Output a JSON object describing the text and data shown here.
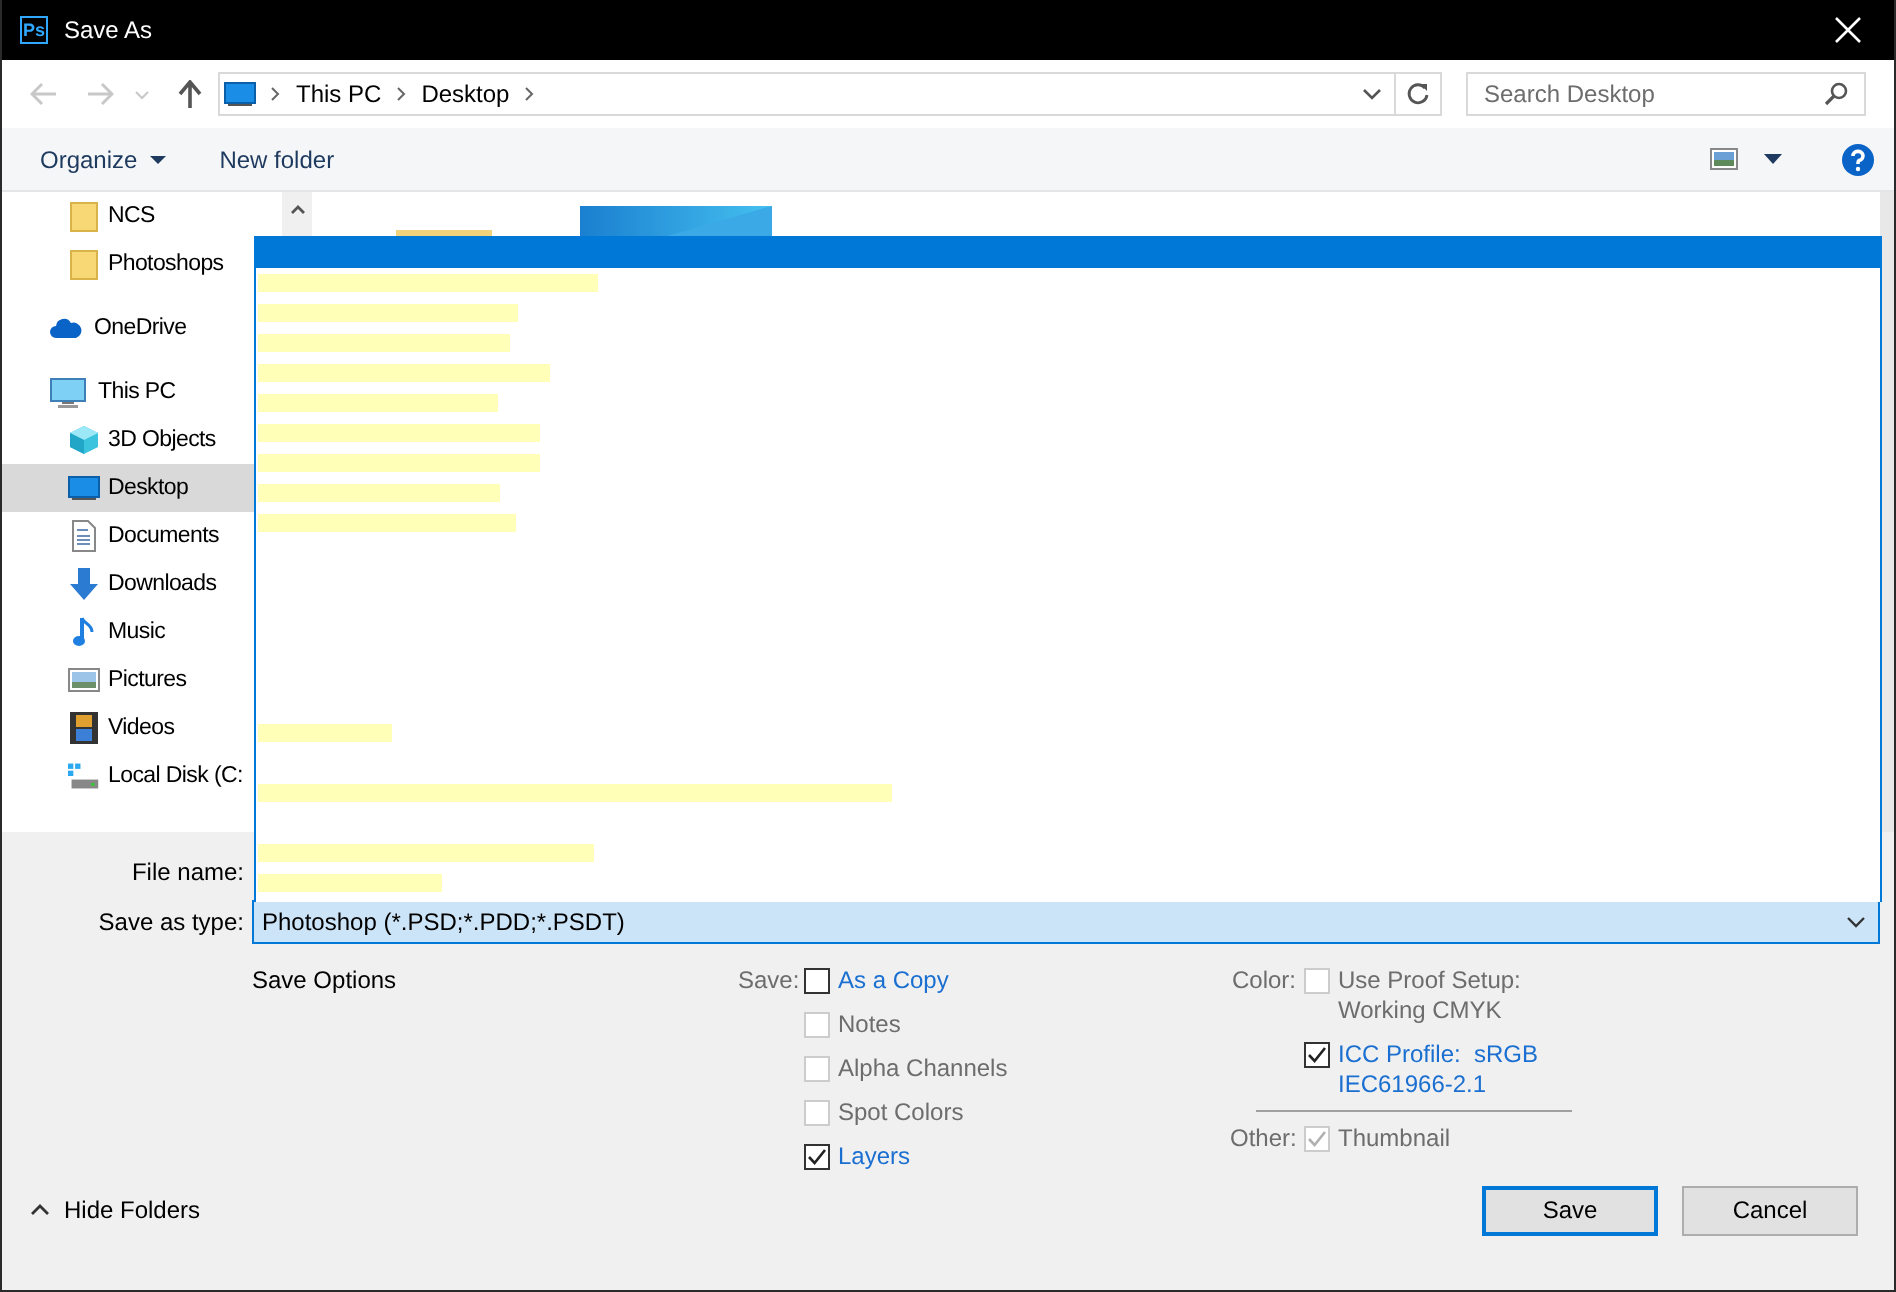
{
  "window": {
    "app_icon_text": "Ps",
    "title": "Save As"
  },
  "address": {
    "path": [
      "This PC",
      "Desktop"
    ]
  },
  "search": {
    "placeholder": "Search Desktop"
  },
  "toolbar": {
    "organize": "Organize",
    "new_folder": "New folder"
  },
  "sidebar": {
    "quick_access_items": [
      {
        "label": "NCS",
        "selected": false
      },
      {
        "label": "Photoshops",
        "selected": false
      }
    ],
    "items": [
      {
        "label": "OneDrive",
        "selected": false
      },
      {
        "label": "This PC",
        "selected": false,
        "children": [
          {
            "label": "3D Objects",
            "selected": false
          },
          {
            "label": "Desktop",
            "selected": true
          },
          {
            "label": "Documents",
            "selected": false
          },
          {
            "label": "Downloads",
            "selected": false
          },
          {
            "label": "Music",
            "selected": false
          },
          {
            "label": "Pictures",
            "selected": false
          },
          {
            "label": "Videos",
            "selected": false
          },
          {
            "label": "Local Disk (C:",
            "selected": false
          }
        ]
      }
    ]
  },
  "file_name": {
    "label": "File name:"
  },
  "save_as_type": {
    "label": "Save as type:",
    "value": "Photoshop (*.PSD;*.PDD;*.PSDT)",
    "expanded": true
  },
  "save_options": {
    "title": "Save Options",
    "save": {
      "label": "Save:",
      "options": [
        {
          "label": "As a Copy",
          "checked": false,
          "disabled": false
        },
        {
          "label": "Notes",
          "checked": false,
          "disabled": true
        },
        {
          "label": "Alpha Channels",
          "checked": false,
          "disabled": true
        },
        {
          "label": "Spot Colors",
          "checked": false,
          "disabled": true
        },
        {
          "label": "Layers",
          "checked": true,
          "disabled": false
        }
      ]
    },
    "color": {
      "label": "Color:",
      "options": [
        {
          "label": "Use Proof Setup: Working CMYK",
          "checked": false,
          "disabled": true
        },
        {
          "label": "ICC Profile:  sRGB IEC61966-2.1",
          "checked": true,
          "disabled": false
        }
      ]
    },
    "other": {
      "label": "Other:",
      "options": [
        {
          "label": "Thumbnail",
          "checked": true,
          "disabled": true
        }
      ]
    }
  },
  "hide_folders": "Hide Folders",
  "buttons": [
    {
      "label": "Save",
      "default": true
    },
    {
      "label": "Cancel",
      "default": false
    }
  ]
}
